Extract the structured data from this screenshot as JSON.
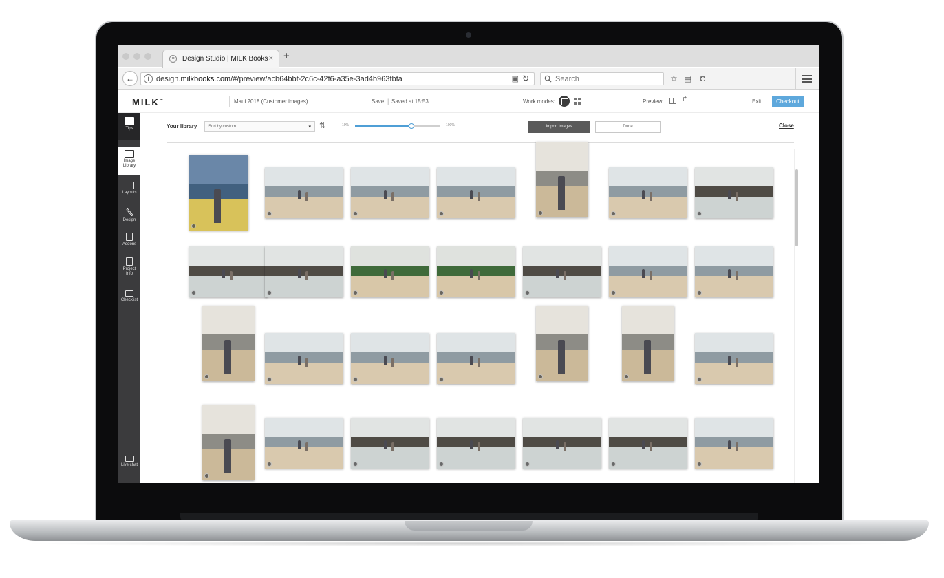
{
  "browser": {
    "tab_title": "Design Studio | MILK Books",
    "tab_close": "×",
    "new_tab": "+",
    "url_domain": "design.",
    "url_host": "milkbooks.com",
    "url_path": "/#/preview/acb64bbf-2c6c-42f6-a35e-3ad4b963fbfa",
    "search_placeholder": "Search"
  },
  "app": {
    "logo": "MILK",
    "logo_tm": "™",
    "project_name": "Maui 2018 (Customer images)",
    "save_label": "Save",
    "separator": "|",
    "saved_status": "Saved at 15:53",
    "work_modes_label": "Work modes:",
    "preview_label": "Preview:",
    "exit_label": "Exit",
    "checkout_label": "Checkout"
  },
  "sidebar": {
    "items": [
      {
        "label": "Tips",
        "label2": "",
        "icon": "lightbulb-icon"
      },
      {
        "label": "Image",
        "label2": "Library",
        "icon": "image-icon"
      },
      {
        "label": "Layouts",
        "label2": "",
        "icon": "layouts-icon"
      },
      {
        "label": "Design",
        "label2": "",
        "icon": "pencil-icon"
      },
      {
        "label": "Addons",
        "label2": "",
        "icon": "addons-icon"
      },
      {
        "label": "Project",
        "label2": "Info",
        "icon": "info-icon"
      },
      {
        "label": "Checklist",
        "label2": "",
        "icon": "checklist-icon"
      }
    ],
    "live_chat": "Live chat"
  },
  "library": {
    "title": "Your library",
    "sort_value": "Sort by custom",
    "zoom_min": "10%",
    "zoom_max": "100%",
    "zoom_level": 0.67,
    "import_label": "Import images",
    "done_label": "Done",
    "close_label": "Close"
  },
  "colors": {
    "accent": "#5ea8dc",
    "sidebar": "#3b3b3d"
  },
  "photos": [
    {
      "scene": "portrait-boy-pier"
    },
    {
      "scene": "beach-couple"
    },
    {
      "scene": "beach-couple-walk"
    },
    {
      "scene": "beach-family-sitting"
    },
    {
      "scene": "portrait-woman-rock"
    },
    {
      "scene": "beach-child-waves"
    },
    {
      "scene": "rocky-shore"
    },
    {
      "scene": "rock-family"
    },
    {
      "scene": "rock-family"
    },
    {
      "scene": "green-cliff-couple"
    },
    {
      "scene": "green-cliff-children"
    },
    {
      "scene": "rocky-shore"
    },
    {
      "scene": "beach-play"
    },
    {
      "scene": "beach-group"
    },
    {
      "scene": "portrait-parent-child"
    },
    {
      "scene": "beach-walk"
    },
    {
      "scene": "beach-family-run"
    },
    {
      "scene": "beach-family-waves"
    },
    {
      "scene": "portrait-boy-beach"
    },
    {
      "scene": "portrait-boy-rock"
    },
    {
      "scene": "beach-family-line"
    },
    {
      "scene": "portrait-father-son"
    },
    {
      "scene": "beach-waves-child"
    },
    {
      "scene": "beach-rock-child"
    },
    {
      "scene": "rock-two-boys"
    },
    {
      "scene": "rock-two-boys"
    },
    {
      "scene": "rock-two-boys"
    },
    {
      "scene": "beach-hug"
    }
  ]
}
